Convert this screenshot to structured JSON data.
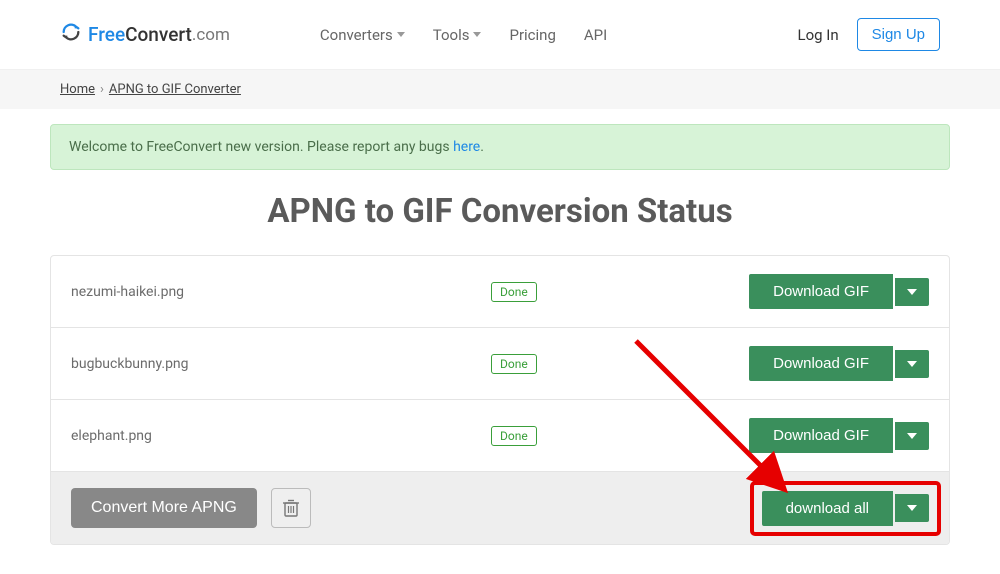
{
  "header": {
    "logo_free": "Free",
    "logo_convert": "Convert",
    "logo_com": ".com",
    "nav": [
      {
        "label": "Converters",
        "has_dropdown": true
      },
      {
        "label": "Tools",
        "has_dropdown": true
      },
      {
        "label": "Pricing",
        "has_dropdown": false
      },
      {
        "label": "API",
        "has_dropdown": false
      }
    ],
    "login_label": "Log In",
    "signup_label": "Sign Up"
  },
  "breadcrumb": {
    "home": "Home",
    "current": "APNG to GIF Converter"
  },
  "alert": {
    "text_prefix": "Welcome to FreeConvert new version. Please report any bugs ",
    "link": "here",
    "suffix": "."
  },
  "page_title": "APNG to GIF Conversion Status",
  "files": [
    {
      "name": "nezumi-haikei.png",
      "status": "Done",
      "download_label": "Download GIF"
    },
    {
      "name": "bugbuckbunny.png",
      "status": "Done",
      "download_label": "Download GIF"
    },
    {
      "name": "elephant.png",
      "status": "Done",
      "download_label": "Download GIF"
    }
  ],
  "footer": {
    "convert_more_label": "Convert More APNG",
    "download_all_label": "download all"
  },
  "colors": {
    "accent_green": "#3a8f5c",
    "accent_blue": "#1e88e5",
    "annotation_red": "#e60000"
  }
}
